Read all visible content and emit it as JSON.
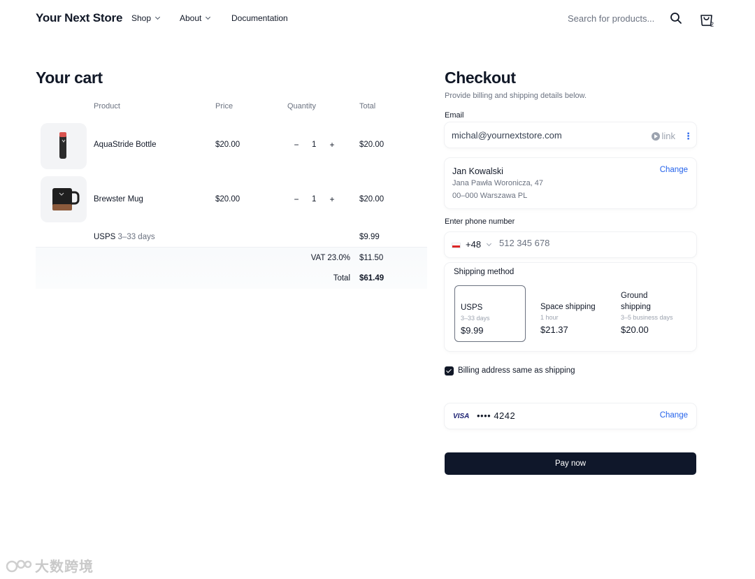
{
  "header": {
    "brand": "Your Next Store",
    "nav": [
      {
        "label": "Shop",
        "has_dropdown": true
      },
      {
        "label": "About",
        "has_dropdown": true
      },
      {
        "label": "Documentation",
        "has_dropdown": false
      }
    ],
    "search_placeholder": "Search for products...",
    "cart_count": "2"
  },
  "cart": {
    "title": "Your cart",
    "columns": [
      "Product",
      "Price",
      "Quantity",
      "Total"
    ],
    "items": [
      {
        "name": "AquaStride Bottle",
        "price": "$20.00",
        "quantity": "1",
        "total": "$20.00",
        "icon": "bottle-icon"
      },
      {
        "name": "Brewster Mug",
        "price": "$20.00",
        "quantity": "1",
        "total": "$20.00",
        "icon": "mug-icon"
      }
    ],
    "qty_minus": "−",
    "qty_plus": "+",
    "shipping": {
      "carrier": "USPS",
      "days": "3–33 days",
      "price": "$9.99"
    },
    "vat": {
      "label": "VAT 23.0%",
      "value": "$11.50"
    },
    "total": {
      "label": "Total",
      "value": "$61.49"
    }
  },
  "checkout": {
    "title": "Checkout",
    "subtitle": "Provide billing and shipping details below.",
    "email_label": "Email",
    "email_value": "michal@yournextstore.com",
    "link_badge": "link",
    "address": {
      "name": "Jan Kowalski",
      "line1": "Jana Pawła Woronicza, 47",
      "line2": "00–000 Warszawa PL",
      "change": "Change"
    },
    "phone_label": "Enter phone number",
    "phone_code": "+48",
    "phone_placeholder": "512 345 678",
    "shipping_method": {
      "title": "Shipping method",
      "options": [
        {
          "name": "USPS",
          "time": "3–33 days",
          "price": "$9.99",
          "selected": true
        },
        {
          "name": "Space shipping",
          "time": "1 hour",
          "price": "$21.37",
          "selected": false
        },
        {
          "name": "Ground shipping",
          "time": "3–5 business days",
          "price": "$20.00",
          "selected": false
        }
      ]
    },
    "billing_same_label": "Billing address same as shipping",
    "billing_same_checked": true,
    "card": {
      "brand": "VISA",
      "masked": "•••• 4242",
      "change": "Change"
    },
    "pay_button": "Pay now"
  },
  "watermark": "大数跨境",
  "colors": {
    "accent_link": "#2563eb",
    "pay_button": "#0f172a",
    "muted": "#6b7280"
  }
}
